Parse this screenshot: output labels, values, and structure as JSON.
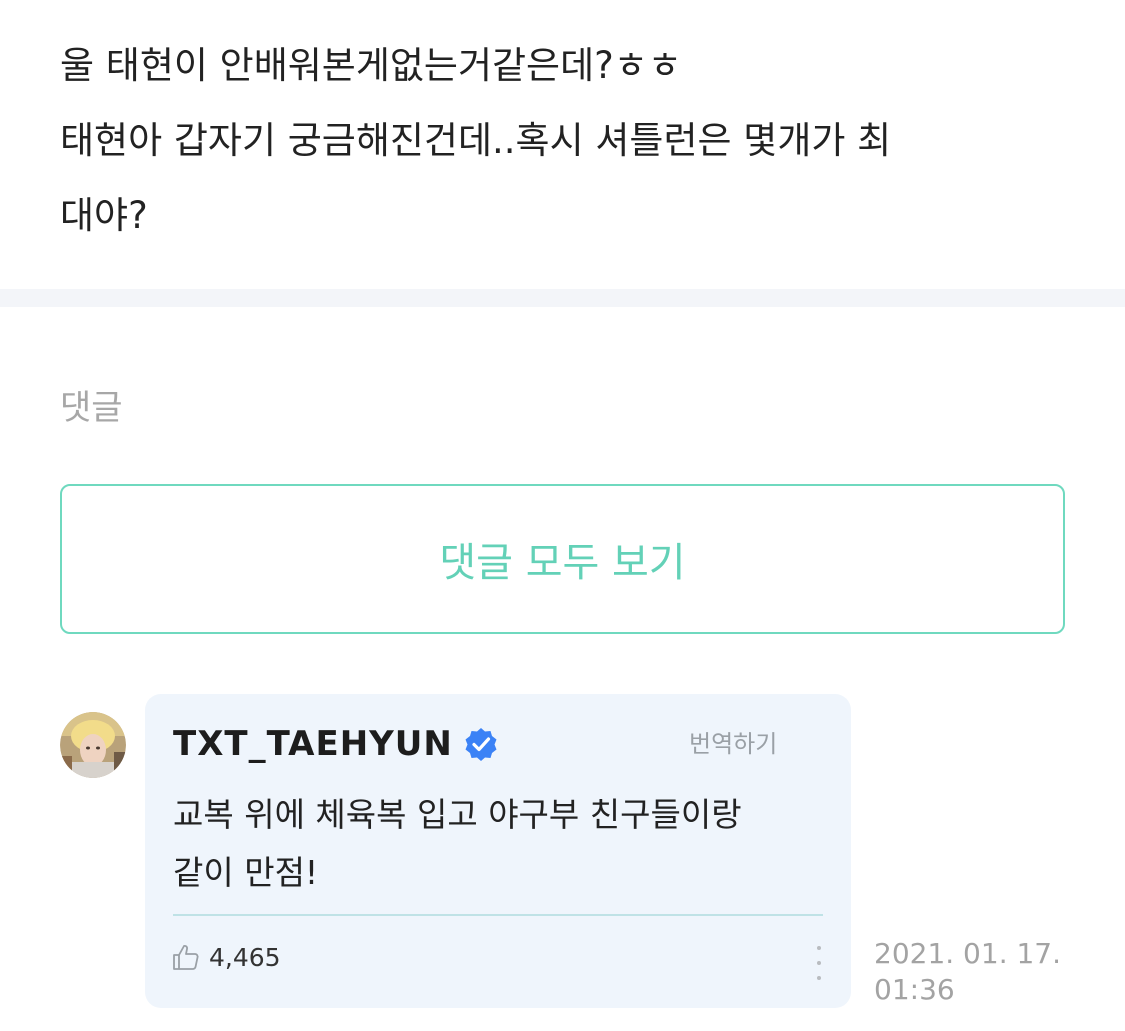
{
  "post": {
    "lines": [
      "울 태현이 안배워본게없는거같은데?ㅎㅎ",
      "태현아 갑자기 궁금해진건데..혹시 셔틀런은 몇개가 최",
      "대야?"
    ]
  },
  "comments_section": {
    "heading": "댓글",
    "view_all_label": "댓글 모두 보기"
  },
  "comment": {
    "author": "TXT_TAEHYUN",
    "verified_icon": "verified-badge-icon",
    "translate_label": "번역하기",
    "text_lines": [
      "교복 위에 체육복 입고 야구부 친구들이랑",
      "같이 만점!"
    ],
    "likes": "4,465",
    "like_icon": "thumbs-up-icon",
    "more_icon": "more-vertical-icon",
    "date": "2021. 01. 17.",
    "time": "01:36"
  },
  "colors": {
    "accent": "#63d1b7",
    "card_bg": "#eff5fc",
    "verified": "#3b82f6",
    "band": "#f3f5f9"
  }
}
